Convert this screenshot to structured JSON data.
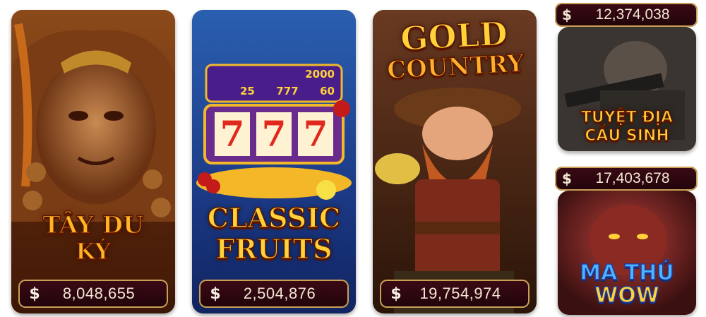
{
  "colors": {
    "jackpot_bg": "#2b0610",
    "jackpot_border": "#c8a055",
    "gold_text": "#ffd23a"
  },
  "currency_symbol": "$",
  "games": [
    {
      "title_line1": "TÂY DU",
      "title_line2": "KÝ",
      "jackpot": "8,048,655",
      "icon": "monkey-king-art"
    },
    {
      "title_line1": "CLASSIC",
      "title_line2": "FRUITS",
      "jackpot": "2,504,876",
      "icon": "slot-machine-art",
      "reels": [
        "7",
        "7",
        "7"
      ],
      "paytable": [
        "2000",
        "25",
        "777",
        "60"
      ]
    },
    {
      "title_line1": "GOLD",
      "title_line2": "COUNTRY",
      "jackpot": "19,754,974",
      "icon": "miner-art"
    },
    {
      "title_line1": "TUYỆT ĐỊA",
      "title_line2": "CẦU SINH",
      "jackpot": "12,374,038",
      "icon": "soldier-art"
    },
    {
      "title_line1": "MA THÚ",
      "title_line2": "WOW",
      "jackpot": "17,403,678",
      "icon": "demon-art"
    }
  ]
}
